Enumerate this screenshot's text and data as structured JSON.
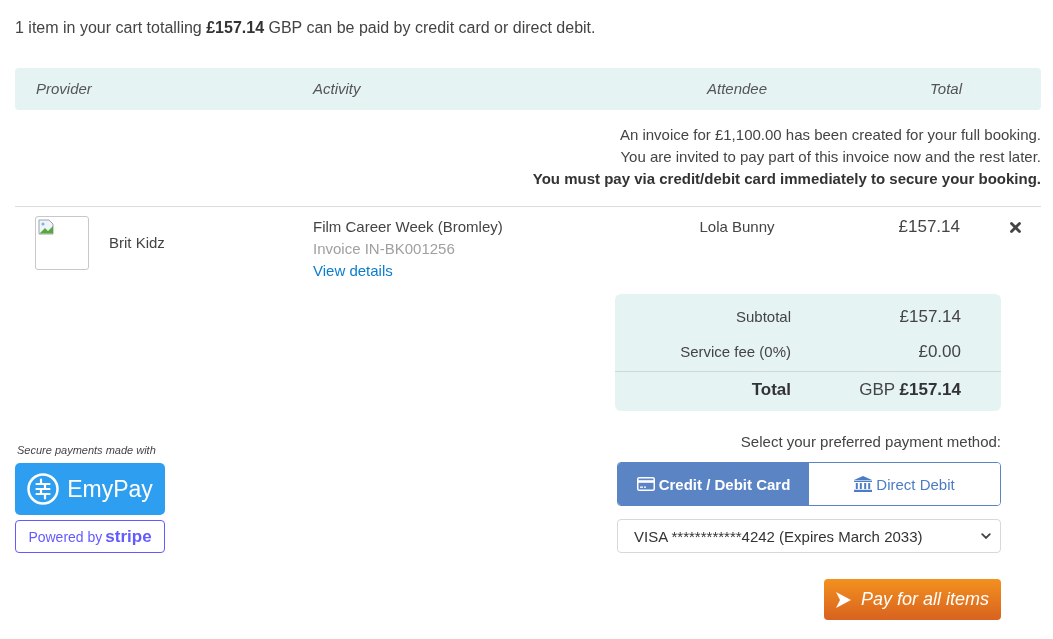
{
  "intro": "1 item in your cart totalling **£157.14** GBP can be paid by credit card or direct debit.",
  "table": {
    "columns": [
      "Provider",
      "Activity",
      "Attendee",
      "Total"
    ],
    "notice": [
      {
        "text": "An invoice for £1,100.00 has been created for your full booking.",
        "kind": "info"
      },
      {
        "text": "You are invited to pay part of this invoice now and the rest later.",
        "kind": "info"
      },
      {
        "text": "You must pay via credit/debit card immediately to secure your booking.",
        "kind": "important"
      }
    ],
    "rows": [
      {
        "provider": "Brit Kidz",
        "activity": "Film Career Week (Bromley)",
        "invoice": "Invoice IN-BK001256",
        "link": "View details",
        "attendee": "Lola Bunny",
        "total": "£157.14"
      }
    ]
  },
  "summary": [
    {
      "label": "Subtotal",
      "value": "£157.14",
      "kind": "line"
    },
    {
      "label": "Service fee (0%)",
      "value": "£0.00",
      "kind": "line"
    },
    {
      "label": "Total",
      "value": "GBP **£157.14**",
      "kind": "total"
    }
  ],
  "payment_badges": {
    "caption": "Secure payments made with",
    "brand": "EmyPay",
    "powered_by": "Powered by **stripe**"
  },
  "payment": {
    "prompt": "Select your preferred payment method:",
    "methods": [
      {
        "label": "Credit / Debit Card",
        "kind": "card",
        "selected": true
      },
      {
        "label": "Direct Debit",
        "kind": "bank",
        "selected": false
      }
    ],
    "card_select": {
      "value": "VISA ************4242 (Expires March 2033)"
    },
    "pay_button": "Pay for all items"
  }
}
